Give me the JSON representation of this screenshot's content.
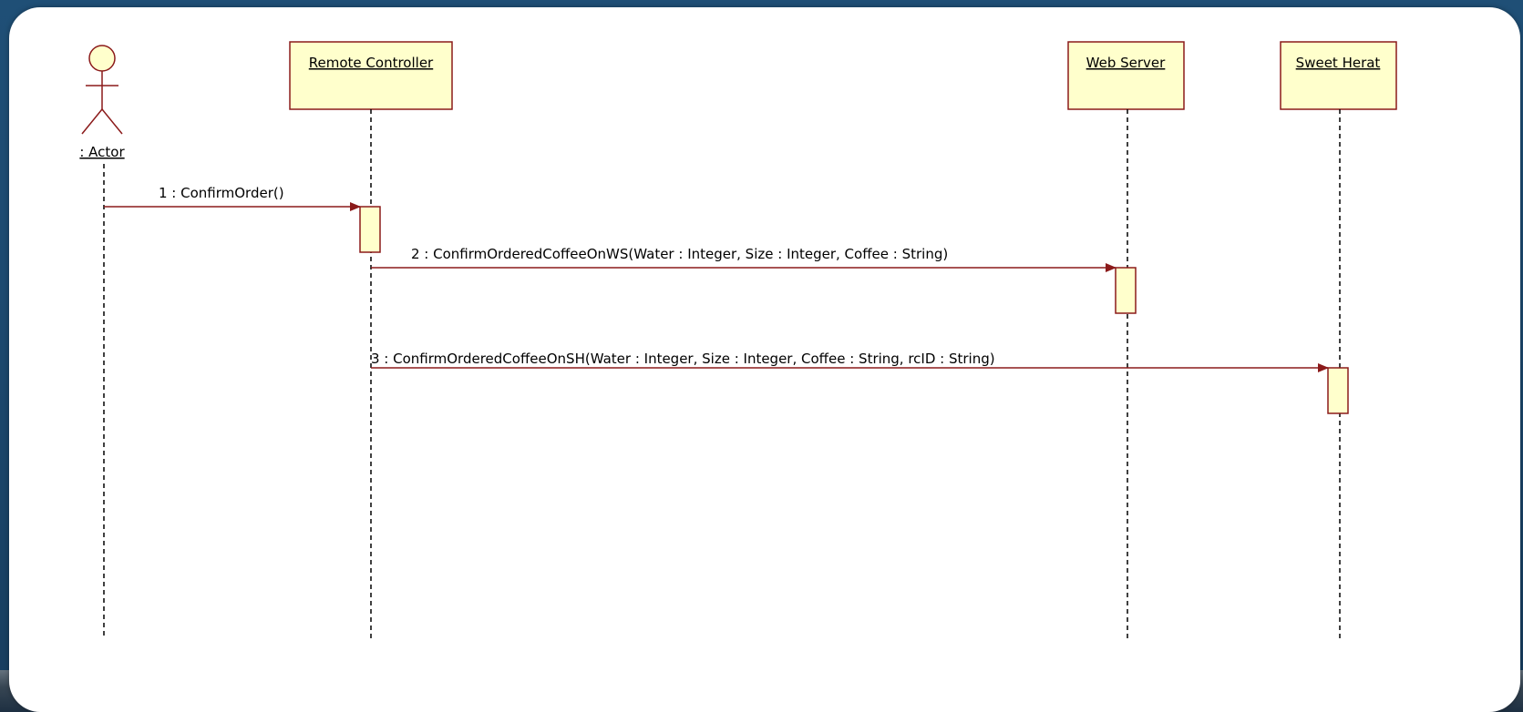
{
  "diagram": {
    "colors": {
      "line": "#8b1a1a",
      "box_fill": "#ffffcc",
      "text": "#000000",
      "lifeline": "#000000"
    },
    "actor": {
      "label": ": Actor"
    },
    "objects": [
      {
        "id": "remote-controller",
        "label": "Remote Controller"
      },
      {
        "id": "web-server",
        "label": "Web Server"
      },
      {
        "id": "sweet-herat",
        "label": "Sweet Herat"
      }
    ],
    "messages": [
      {
        "from": "actor",
        "to": "remote-controller",
        "label": "1 : ConfirmOrder()"
      },
      {
        "from": "remote-controller",
        "to": "web-server",
        "label": "2 : ConfirmOrderedCoffeeOnWS(Water : Integer, Size : Integer, Coffee : String)"
      },
      {
        "from": "remote-controller",
        "to": "sweet-herat",
        "label": "3 : ConfirmOrderedCoffeeOnSH(Water : Integer, Size : Integer, Coffee : String, rcID : String)"
      }
    ]
  }
}
